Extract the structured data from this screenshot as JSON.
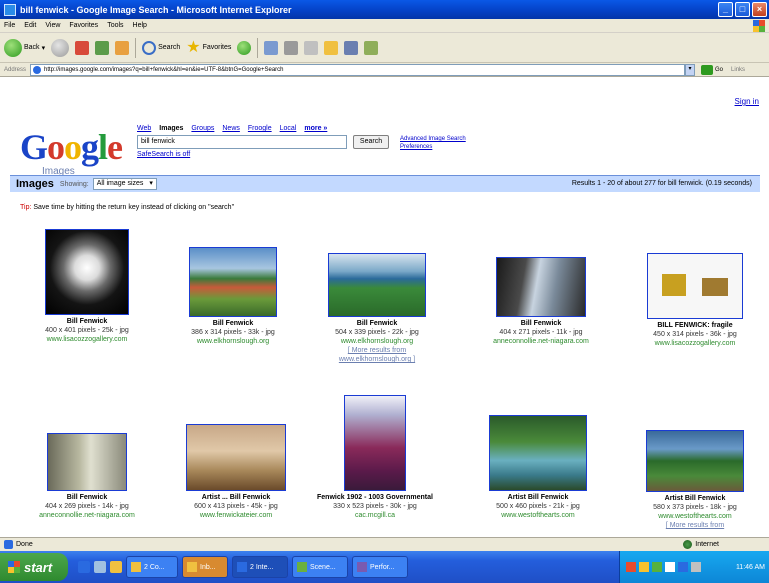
{
  "window": {
    "title": "bill fenwick - Google Image Search - Microsoft Internet Explorer"
  },
  "menu": [
    "File",
    "Edit",
    "View",
    "Favorites",
    "Tools",
    "Help"
  ],
  "toolbar": {
    "back": "Back",
    "search": "Search",
    "favorites": "Favorites"
  },
  "address": {
    "label": "Address",
    "url": "http://images.google.com/images?q=bill+fenwick&hl=en&ie=UTF-8&btnG=Google+Search",
    "go": "Go",
    "links": "Links"
  },
  "page": {
    "signin": "Sign in",
    "logo_sub": "Images",
    "tabs": [
      "Web",
      "Images",
      "Groups",
      "News",
      "Froogle",
      "Local",
      "more »"
    ],
    "search_value": "bill fenwick",
    "search_button": "Search",
    "advanced": "Advanced Image Search",
    "preferences": "Preferences",
    "safesearch": "SafeSearch is off",
    "results_heading": "Images",
    "showing": "Showing:",
    "size_select": "All image sizes",
    "results_count": "Results 1 - 20 of about 277 for bill fenwick. (0.19 seconds)",
    "tip_label": "Tip:",
    "tip_text": "Save time by hitting the return key instead of clicking on \"search\""
  },
  "results": [
    {
      "name": "Bill Fenwick",
      "meta": "400 x 401 pixels - 25k - jpg",
      "url": "www.lisacozzogallery.com",
      "more": ""
    },
    {
      "name": "Bill Fenwick",
      "meta": "386 x 314 pixels - 33k - jpg",
      "url": "www.elkhornslough.org",
      "more": ""
    },
    {
      "name": "Bill Fenwick",
      "meta": "504 x 339 pixels - 22k - jpg",
      "url": "www.elkhornslough.org",
      "more": "[ More results from www.elkhornslough.org ]"
    },
    {
      "name": "Bill Fenwick",
      "meta": "404 x 271 pixels - 11k - jpg",
      "url": "anneconnollie.net-niagara.com",
      "more": ""
    },
    {
      "name": "BILL FENWICK: fragile",
      "meta": "450 x 314 pixels - 36k - jpg",
      "url": "www.lisacozzogallery.com",
      "more": ""
    },
    {
      "name": "Bill Fenwick",
      "meta": "404 x 269 pixels - 14k - jpg",
      "url": "anneconnollie.net-niagara.com",
      "more": ""
    },
    {
      "name": "Artist ... Bill Fenwick",
      "meta": "600 x 413 pixels - 45k - jpg",
      "url": "www.fenwickateier.com",
      "more": ""
    },
    {
      "name": "Fenwick 1902 - 1003 Governmental",
      "meta": "330 x 523 pixels - 30k - jpg",
      "url": "cac.mcgill.ca",
      "more": ""
    },
    {
      "name": "Artist Bill Fenwick",
      "meta": "500 x 460 pixels - 21k - jpg",
      "url": "www.westofthearts.com",
      "more": ""
    },
    {
      "name": "Artist Bill Fenwick",
      "meta": "580 x 373 pixels - 18k - jpg",
      "url": "www.westofthearts.com",
      "more": "[ More results from"
    }
  ],
  "status": {
    "left": "Done",
    "zone": "Internet"
  },
  "taskbar": {
    "start": "start",
    "tasks": [
      "2 Co...",
      "Inb...",
      "2 Inte...",
      "Scene...",
      "Perfor..."
    ],
    "clock": "11:46 AM"
  }
}
